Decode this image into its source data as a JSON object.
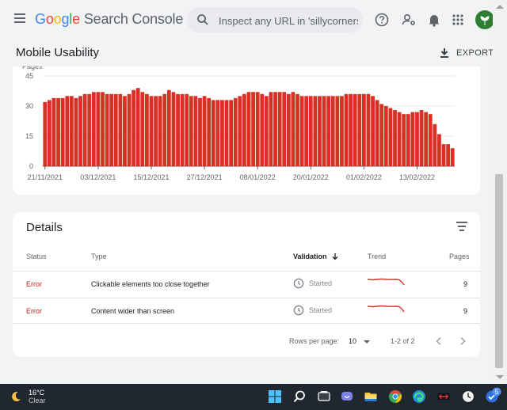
{
  "header": {
    "logo_letters": [
      {
        "ch": "G",
        "color": "#4285F4"
      },
      {
        "ch": "o",
        "color": "#EA4335"
      },
      {
        "ch": "o",
        "color": "#FBBC05"
      },
      {
        "ch": "g",
        "color": "#4285F4"
      },
      {
        "ch": "l",
        "color": "#34A853"
      },
      {
        "ch": "e",
        "color": "#EA4335"
      }
    ],
    "product": "Search Console",
    "search_placeholder": "Inspect any URL in 'sillycorners",
    "icons": [
      "menu-icon",
      "search-icon",
      "help-icon",
      "manage-users-icon",
      "notifications-icon",
      "apps-grid-icon",
      "account-avatar-icon"
    ]
  },
  "page": {
    "title": "Mobile Usability",
    "export_label": "EXPORT"
  },
  "chart_data": {
    "type": "bar",
    "ylabel": "Pages",
    "ylim": [
      0,
      45
    ],
    "yticks": [
      0,
      15,
      30,
      45
    ],
    "xtick_labels": [
      "21/11/2021",
      "03/12/2021",
      "15/12/2021",
      "27/12/2021",
      "08/01/2022",
      "20/01/2022",
      "01/02/2022",
      "13/02/2022"
    ],
    "color": "#d93025",
    "values": [
      32,
      33,
      34,
      34,
      34,
      35,
      35,
      34,
      35,
      36,
      36,
      37,
      37,
      37,
      36,
      36,
      36,
      36,
      35,
      36,
      38,
      39,
      37,
      36,
      35,
      35,
      35,
      36,
      38,
      37,
      36,
      36,
      36,
      35,
      35,
      34,
      35,
      34,
      33,
      33,
      33,
      33,
      33,
      34,
      35,
      36,
      37,
      37,
      37,
      36,
      35,
      37,
      37,
      37,
      37,
      36,
      37,
      36,
      35,
      35,
      35,
      35,
      35,
      35,
      35,
      35,
      35,
      35,
      36,
      36,
      36,
      36,
      36,
      36,
      35,
      33,
      31,
      30,
      29,
      28,
      27,
      26,
      26,
      27,
      27,
      28,
      27,
      26,
      21,
      16,
      11,
      11,
      9
    ]
  },
  "details": {
    "title": "Details",
    "columns": {
      "status": "Status",
      "type": "Type",
      "validation": "Validation",
      "trend": "Trend",
      "pages": "Pages"
    },
    "rows": [
      {
        "status": "Error",
        "type": "Clickable elements too close together",
        "validation": "Started",
        "pages": "9"
      },
      {
        "status": "Error",
        "type": "Content wider than screen",
        "validation": "Started",
        "pages": "9"
      }
    ],
    "pagination": {
      "rows_label": "Rows per page:",
      "rows_value": "10",
      "range": "1-2 of 2"
    }
  },
  "taskbar": {
    "temperature": "16°C",
    "condition": "Clear",
    "badge": "5",
    "apps": [
      "start-icon",
      "search-icon",
      "task-view-icon",
      "teams-chat-icon",
      "file-explorer-icon",
      "chrome-icon",
      "edge-icon",
      "app-icon",
      "clock-icon",
      "tasks-icon"
    ]
  }
}
